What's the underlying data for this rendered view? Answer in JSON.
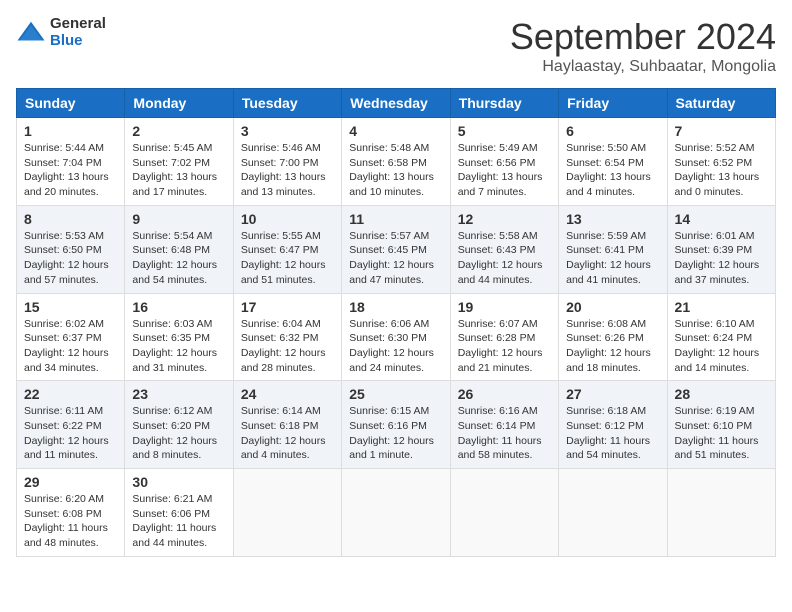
{
  "header": {
    "logo_general": "General",
    "logo_blue": "Blue",
    "month": "September 2024",
    "location": "Haylaastay, Suhbaatar, Mongolia"
  },
  "weekdays": [
    "Sunday",
    "Monday",
    "Tuesday",
    "Wednesday",
    "Thursday",
    "Friday",
    "Saturday"
  ],
  "weeks": [
    [
      {
        "day": "1",
        "info": "Sunrise: 5:44 AM\nSunset: 7:04 PM\nDaylight: 13 hours\nand 20 minutes."
      },
      {
        "day": "2",
        "info": "Sunrise: 5:45 AM\nSunset: 7:02 PM\nDaylight: 13 hours\nand 17 minutes."
      },
      {
        "day": "3",
        "info": "Sunrise: 5:46 AM\nSunset: 7:00 PM\nDaylight: 13 hours\nand 13 minutes."
      },
      {
        "day": "4",
        "info": "Sunrise: 5:48 AM\nSunset: 6:58 PM\nDaylight: 13 hours\nand 10 minutes."
      },
      {
        "day": "5",
        "info": "Sunrise: 5:49 AM\nSunset: 6:56 PM\nDaylight: 13 hours\nand 7 minutes."
      },
      {
        "day": "6",
        "info": "Sunrise: 5:50 AM\nSunset: 6:54 PM\nDaylight: 13 hours\nand 4 minutes."
      },
      {
        "day": "7",
        "info": "Sunrise: 5:52 AM\nSunset: 6:52 PM\nDaylight: 13 hours\nand 0 minutes."
      }
    ],
    [
      {
        "day": "8",
        "info": "Sunrise: 5:53 AM\nSunset: 6:50 PM\nDaylight: 12 hours\nand 57 minutes."
      },
      {
        "day": "9",
        "info": "Sunrise: 5:54 AM\nSunset: 6:48 PM\nDaylight: 12 hours\nand 54 minutes."
      },
      {
        "day": "10",
        "info": "Sunrise: 5:55 AM\nSunset: 6:47 PM\nDaylight: 12 hours\nand 51 minutes."
      },
      {
        "day": "11",
        "info": "Sunrise: 5:57 AM\nSunset: 6:45 PM\nDaylight: 12 hours\nand 47 minutes."
      },
      {
        "day": "12",
        "info": "Sunrise: 5:58 AM\nSunset: 6:43 PM\nDaylight: 12 hours\nand 44 minutes."
      },
      {
        "day": "13",
        "info": "Sunrise: 5:59 AM\nSunset: 6:41 PM\nDaylight: 12 hours\nand 41 minutes."
      },
      {
        "day": "14",
        "info": "Sunrise: 6:01 AM\nSunset: 6:39 PM\nDaylight: 12 hours\nand 37 minutes."
      }
    ],
    [
      {
        "day": "15",
        "info": "Sunrise: 6:02 AM\nSunset: 6:37 PM\nDaylight: 12 hours\nand 34 minutes."
      },
      {
        "day": "16",
        "info": "Sunrise: 6:03 AM\nSunset: 6:35 PM\nDaylight: 12 hours\nand 31 minutes."
      },
      {
        "day": "17",
        "info": "Sunrise: 6:04 AM\nSunset: 6:32 PM\nDaylight: 12 hours\nand 28 minutes."
      },
      {
        "day": "18",
        "info": "Sunrise: 6:06 AM\nSunset: 6:30 PM\nDaylight: 12 hours\nand 24 minutes."
      },
      {
        "day": "19",
        "info": "Sunrise: 6:07 AM\nSunset: 6:28 PM\nDaylight: 12 hours\nand 21 minutes."
      },
      {
        "day": "20",
        "info": "Sunrise: 6:08 AM\nSunset: 6:26 PM\nDaylight: 12 hours\nand 18 minutes."
      },
      {
        "day": "21",
        "info": "Sunrise: 6:10 AM\nSunset: 6:24 PM\nDaylight: 12 hours\nand 14 minutes."
      }
    ],
    [
      {
        "day": "22",
        "info": "Sunrise: 6:11 AM\nSunset: 6:22 PM\nDaylight: 12 hours\nand 11 minutes."
      },
      {
        "day": "23",
        "info": "Sunrise: 6:12 AM\nSunset: 6:20 PM\nDaylight: 12 hours\nand 8 minutes."
      },
      {
        "day": "24",
        "info": "Sunrise: 6:14 AM\nSunset: 6:18 PM\nDaylight: 12 hours\nand 4 minutes."
      },
      {
        "day": "25",
        "info": "Sunrise: 6:15 AM\nSunset: 6:16 PM\nDaylight: 12 hours\nand 1 minute."
      },
      {
        "day": "26",
        "info": "Sunrise: 6:16 AM\nSunset: 6:14 PM\nDaylight: 11 hours\nand 58 minutes."
      },
      {
        "day": "27",
        "info": "Sunrise: 6:18 AM\nSunset: 6:12 PM\nDaylight: 11 hours\nand 54 minutes."
      },
      {
        "day": "28",
        "info": "Sunrise: 6:19 AM\nSunset: 6:10 PM\nDaylight: 11 hours\nand 51 minutes."
      }
    ],
    [
      {
        "day": "29",
        "info": "Sunrise: 6:20 AM\nSunset: 6:08 PM\nDaylight: 11 hours\nand 48 minutes."
      },
      {
        "day": "30",
        "info": "Sunrise: 6:21 AM\nSunset: 6:06 PM\nDaylight: 11 hours\nand 44 minutes."
      },
      {
        "day": "",
        "info": ""
      },
      {
        "day": "",
        "info": ""
      },
      {
        "day": "",
        "info": ""
      },
      {
        "day": "",
        "info": ""
      },
      {
        "day": "",
        "info": ""
      }
    ]
  ]
}
